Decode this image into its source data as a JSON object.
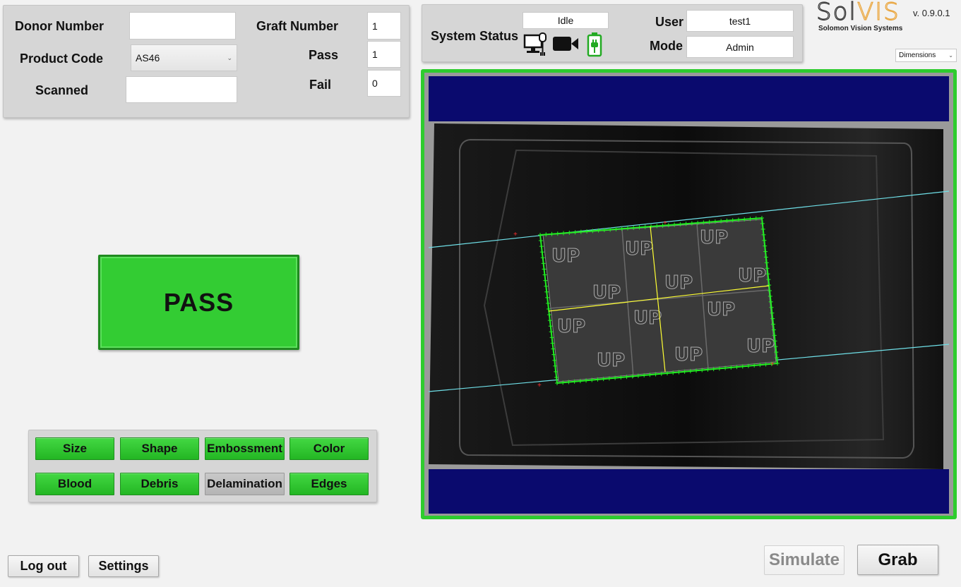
{
  "form": {
    "donor_number_label": "Donor Number",
    "donor_number_value": "",
    "product_code_label": "Product Code",
    "product_code_value": "AS46",
    "scanned_label": "Scanned",
    "scanned_value": "",
    "graft_number_label": "Graft Number",
    "graft_number_value": "1",
    "pass_label": "Pass",
    "pass_value": "1",
    "fail_label": "Fail",
    "fail_value": "0"
  },
  "status": {
    "system_status_label": "System Status",
    "state": "Idle",
    "icons": [
      "computer-icon",
      "camera-icon",
      "battery-icon"
    ],
    "user_label": "User",
    "user_value": "test1",
    "mode_label": "Mode",
    "mode_value": "Admin"
  },
  "brand": {
    "logo_sol": "Sol",
    "logo_vis": "VIS",
    "logo_sub": "Solomon Vision Systems",
    "version": "v. 0.9.0.1",
    "view_select": "Dimensions"
  },
  "result": {
    "label": "PASS",
    "color": "#33cc33"
  },
  "categories": [
    {
      "label": "Size",
      "state": "pass"
    },
    {
      "label": "Shape",
      "state": "pass"
    },
    {
      "label": "Embossment",
      "state": "pass"
    },
    {
      "label": "Color",
      "state": "pass"
    },
    {
      "label": "Blood",
      "state": "pass"
    },
    {
      "label": "Debris",
      "state": "pass"
    },
    {
      "label": "Delamination",
      "state": "inactive"
    },
    {
      "label": "Edges",
      "state": "pass"
    }
  ],
  "image_panel": {
    "border_color": "#2ecc2e",
    "band_color": "#0a0a6e",
    "graft_text": [
      "UP",
      "UP",
      "UP",
      "UP",
      "UP",
      "UP",
      "UP",
      "UP",
      "UP",
      "UP",
      "UP",
      "UP"
    ]
  },
  "footer": {
    "logout_label": "Log out",
    "settings_label": "Settings",
    "simulate_label": "Simulate",
    "grab_label": "Grab"
  },
  "colors": {
    "accent_green": "#33cc33",
    "logo_orange": "#e8a33a",
    "navy": "#0a0a6e"
  }
}
